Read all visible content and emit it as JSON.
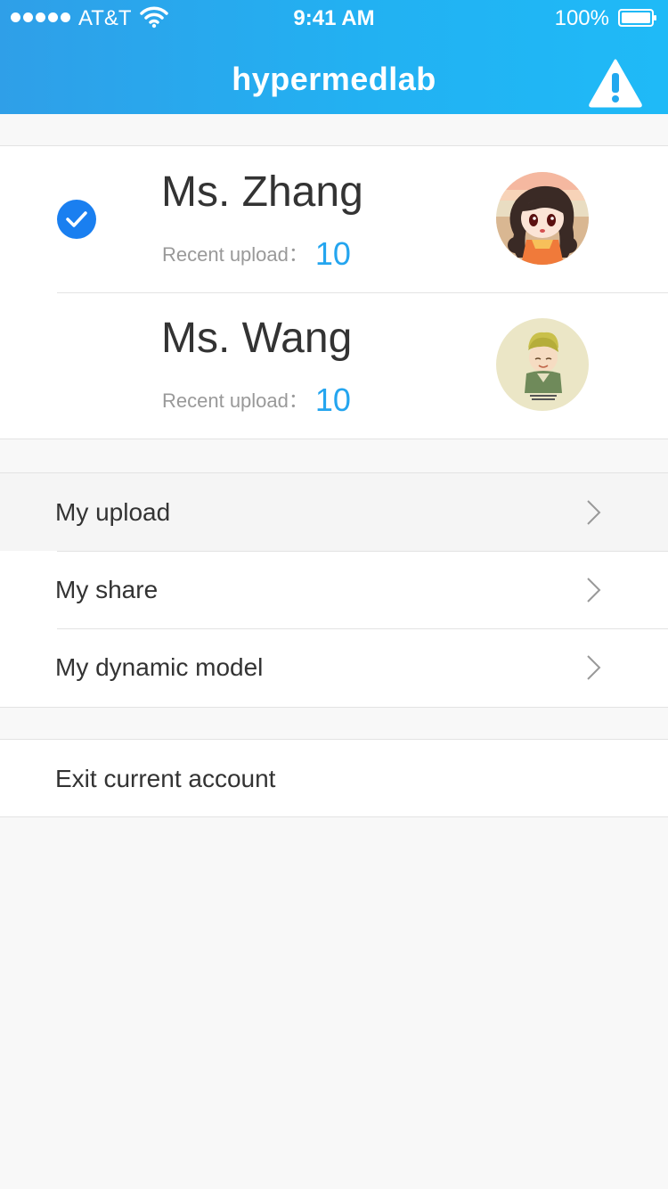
{
  "status_bar": {
    "carrier": "AT&T",
    "time": "9:41 AM",
    "battery": "100%"
  },
  "header": {
    "title": "hypermedlab",
    "warning_icon": "warning-icon"
  },
  "accounts": [
    {
      "name": "Ms. Zhang",
      "meta_label": "Recent upload：",
      "count": "10",
      "selected": true
    },
    {
      "name": "Ms. Wang",
      "meta_label": "Recent upload：",
      "count": "10",
      "selected": false
    }
  ],
  "menu": [
    {
      "label": "My upload"
    },
    {
      "label": "My share"
    },
    {
      "label": "My dynamic model"
    }
  ],
  "exit": {
    "label": "Exit current account"
  },
  "colors": {
    "header_start": "#2f9fe8",
    "header_end": "#1fbaf7",
    "accent": "#24a5ef",
    "check": "#1a7ff0"
  }
}
